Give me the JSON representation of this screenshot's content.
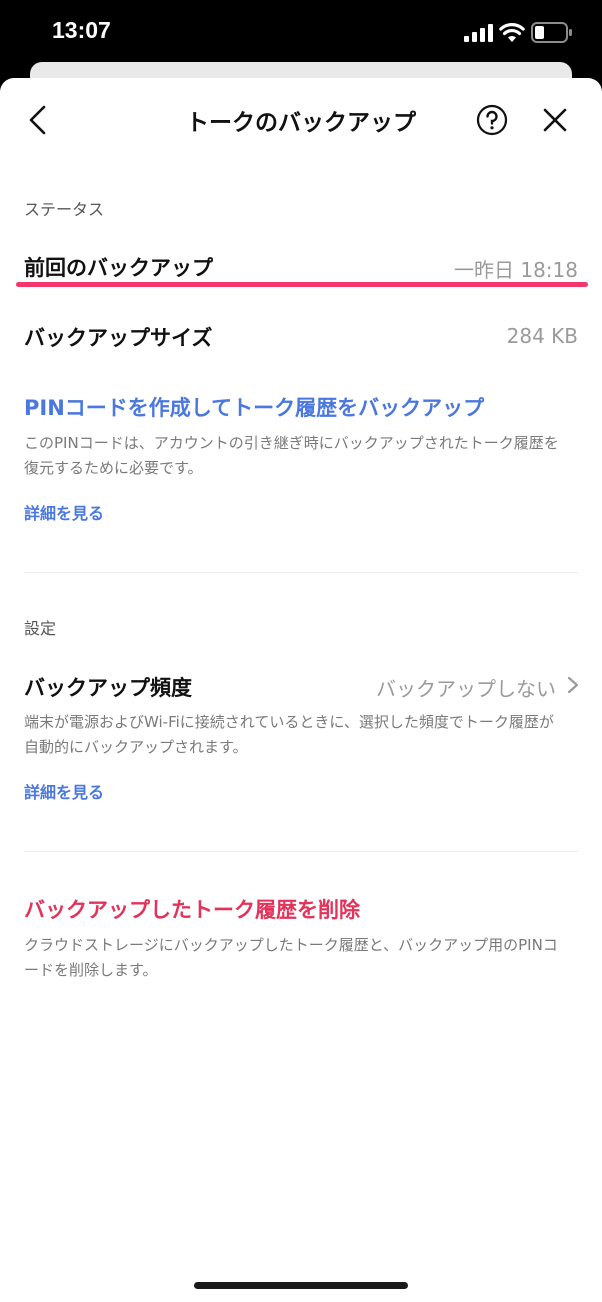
{
  "status_bar": {
    "time": "13:07"
  },
  "header": {
    "title": "トークのバックアップ",
    "back_icon": "chevron-left-icon",
    "help_icon": "question-circle-icon",
    "close_icon": "close-icon"
  },
  "status_section": {
    "label": "ステータス",
    "last_backup_label": "前回のバックアップ",
    "last_backup_value": "一昨日 18:18",
    "size_label": "バックアップサイズ",
    "size_value": "284 KB",
    "pin_link": "PINコードを作成してトーク履歴をバックアップ",
    "pin_desc": "このPINコードは、アカウントの引き継ぎ時にバックアップされたトーク履歴を復元するために必要です。",
    "details_link": "詳細を見る"
  },
  "settings_section": {
    "label": "設定",
    "frequency_label": "バックアップ頻度",
    "frequency_value": "バックアップしない",
    "frequency_desc": "端末が電源およびWi-Fiに接続されているときに、選択した頻度でトーク履歴が自動的にバックアップされます。",
    "details_link": "詳細を見る"
  },
  "delete_section": {
    "delete_link": "バックアップしたトーク履歴を削除",
    "delete_desc": "クラウドストレージにバックアップしたトーク履歴と、バックアップ用のPINコードを削除します。"
  },
  "colors": {
    "link_blue": "#4a78df",
    "danger_red": "#e3335a",
    "highlight_pink": "#f2376a"
  }
}
